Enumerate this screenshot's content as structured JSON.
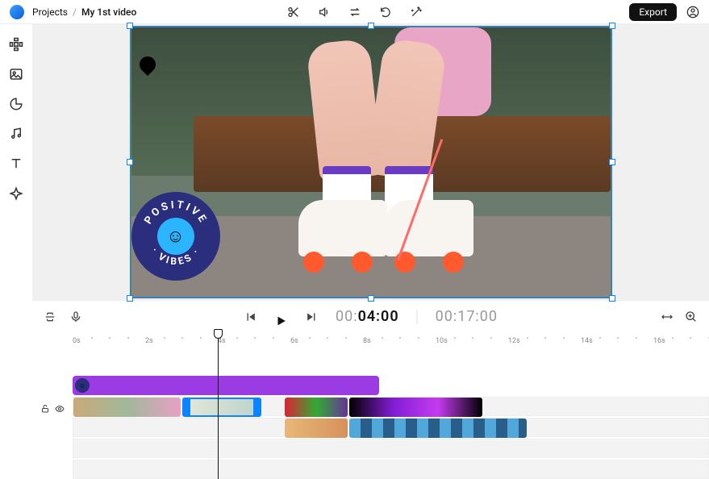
{
  "breadcrumb": {
    "root": "Projects",
    "title": "My 1st video"
  },
  "header": {
    "export_label": "Export"
  },
  "playback": {
    "current_prefix": "00:",
    "current_main": "04:00",
    "total": "00:17:00"
  },
  "ruler": {
    "labels": [
      "0s",
      "2s",
      "4s",
      "6s",
      "8s",
      "10s",
      "12s",
      "14s",
      "16s"
    ]
  },
  "sticker": {
    "top_text": "POSITIVE",
    "bottom_text": "· VIBES ·"
  }
}
